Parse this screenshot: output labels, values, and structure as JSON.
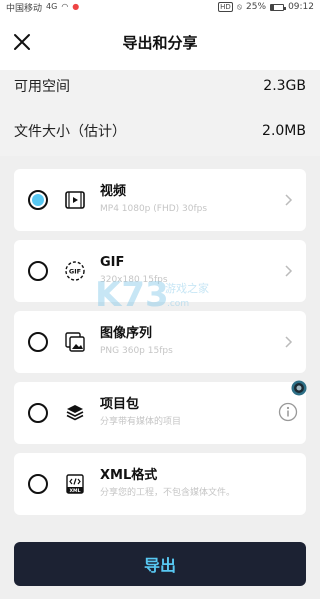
{
  "status_bar": {
    "carrier": "中国移动",
    "signal": "4G",
    "battery": "25%",
    "battery_level": 0.25,
    "time": "09:12",
    "hd": "HD"
  },
  "header": {
    "title": "导出和分享",
    "close_icon": "close-icon"
  },
  "info": {
    "available_label": "可用空间",
    "available_value": "2.3GB",
    "size_label": "文件大小（估计）",
    "size_value": "2.0MB"
  },
  "options": [
    {
      "name": "视频",
      "sub": "MP4 1080p (FHD) 30fps",
      "icon": "video-icon",
      "selected": true,
      "trailing": "chevron-right-icon"
    },
    {
      "name": "GIF",
      "sub": "320x180 15fps",
      "icon": "gif-icon",
      "selected": false,
      "trailing": "chevron-right-icon"
    },
    {
      "name": "图像序列",
      "sub": "PNG 360p 15fps",
      "icon": "image-sequence-icon",
      "selected": false,
      "trailing": "chevron-right-icon"
    },
    {
      "name": "项目包",
      "sub": "分享带有媒体的项目",
      "icon": "project-package-icon",
      "selected": false,
      "trailing": "info-icon"
    },
    {
      "name": "XML格式",
      "sub": "分享您的工程，不包含媒体文件。",
      "icon": "xml-icon",
      "selected": false,
      "trailing": null
    }
  ],
  "export_button": "导出",
  "colors": {
    "accent": "#58c8f2",
    "button_bg": "#1c2233",
    "background": "#efefef"
  }
}
